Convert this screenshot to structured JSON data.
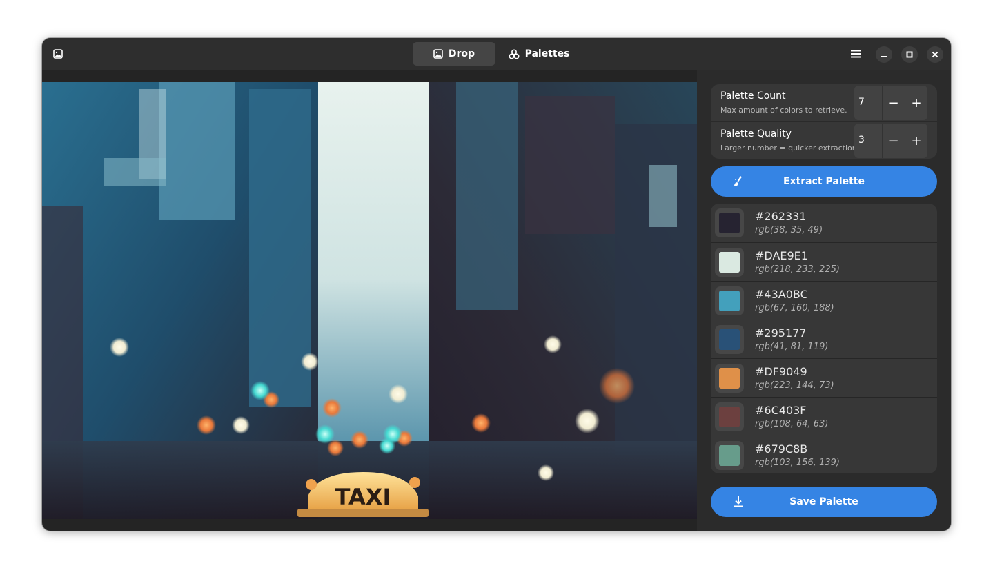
{
  "header": {
    "tabs": [
      {
        "label": "Drop",
        "icon": "image-icon",
        "active": true
      },
      {
        "label": "Palettes",
        "icon": "palette-icon",
        "active": false
      }
    ]
  },
  "settings": {
    "palette_count": {
      "title": "Palette Count",
      "subtitle": "Max amount of colors to retrieve.",
      "value": "7"
    },
    "palette_quality": {
      "title": "Palette Quality",
      "subtitle": "Larger number = quicker extraction.",
      "value": "3"
    },
    "minus": "−",
    "plus": "+"
  },
  "extract_label": "Extract Palette",
  "save_label": "Save Palette",
  "image": {
    "sign_text": "TAXI"
  },
  "colors": [
    {
      "hex": "#262331",
      "rgb": "rgb(38, 35, 49)"
    },
    {
      "hex": "#DAE9E1",
      "rgb": "rgb(218, 233, 225)"
    },
    {
      "hex": "#43A0BC",
      "rgb": "rgb(67, 160, 188)"
    },
    {
      "hex": "#295177",
      "rgb": "rgb(41, 81, 119)"
    },
    {
      "hex": "#DF9049",
      "rgb": "rgb(223, 144, 73)"
    },
    {
      "hex": "#6C403F",
      "rgb": "rgb(108, 64, 63)"
    },
    {
      "hex": "#679C8B",
      "rgb": "rgb(103, 156, 139)"
    }
  ],
  "theme": {
    "accent": "#3584e4",
    "window_bg": "#242424"
  }
}
